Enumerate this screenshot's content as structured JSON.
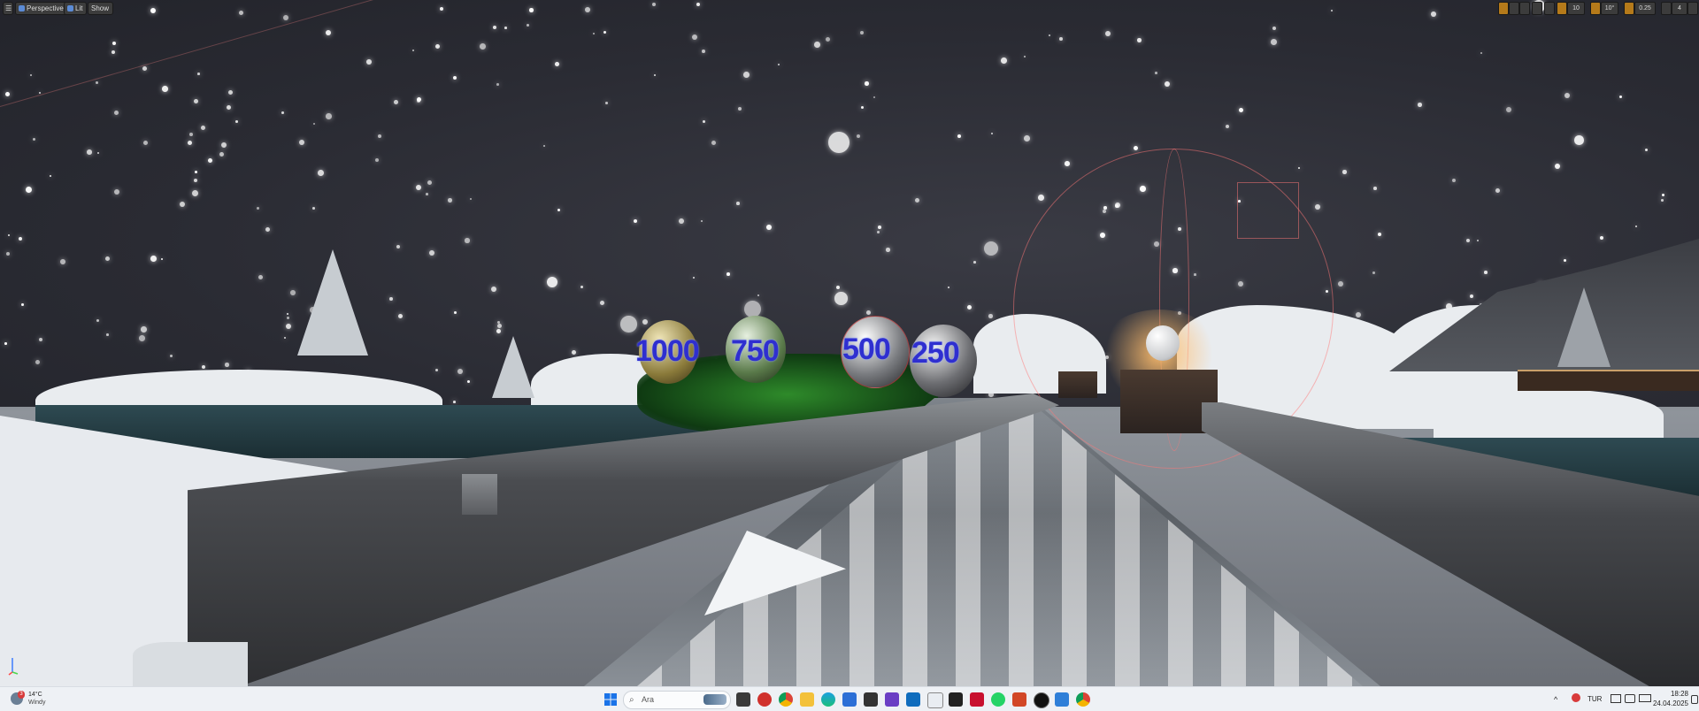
{
  "toolbar": {
    "menu_label": "☰",
    "perspective_label": "Perspective",
    "lit_label": "Lit",
    "show_label": "Show",
    "right": {
      "grid_snap": "10",
      "rotation_snap": "10°",
      "scale_snap": "0.25",
      "camera_speed": "4"
    }
  },
  "scene": {
    "debug_labels": [
      "1000",
      "750",
      "500",
      "250"
    ],
    "description_colors": {
      "sky": "#2b2c35",
      "snow": "#e7eaee",
      "water": "#2e4a52",
      "debug_text": "#2f2fd0",
      "lamp_glow": "#ffbe6e"
    }
  },
  "taskbar": {
    "weather": {
      "temp": "14°C",
      "condition": "Windy",
      "badge": "3"
    },
    "search_placeholder": "Ara",
    "language": "TUR",
    "time": "18:28",
    "date": "24.04.2025",
    "app_icons": [
      "windows-start-icon",
      "search-icon",
      "widgets-icon",
      "task-view-icon",
      "opera-icon",
      "chrome-icon",
      "file-explorer-icon",
      "edge-icon",
      "store-icon",
      "unity-icon",
      "visual-studio-icon",
      "outlook-icon",
      "notepad-icon",
      "epic-games-icon",
      "mcafee-icon",
      "whatsapp-icon",
      "powerpoint-icon",
      "unreal-icon",
      "photos-icon",
      "chrome-alt-icon"
    ]
  }
}
